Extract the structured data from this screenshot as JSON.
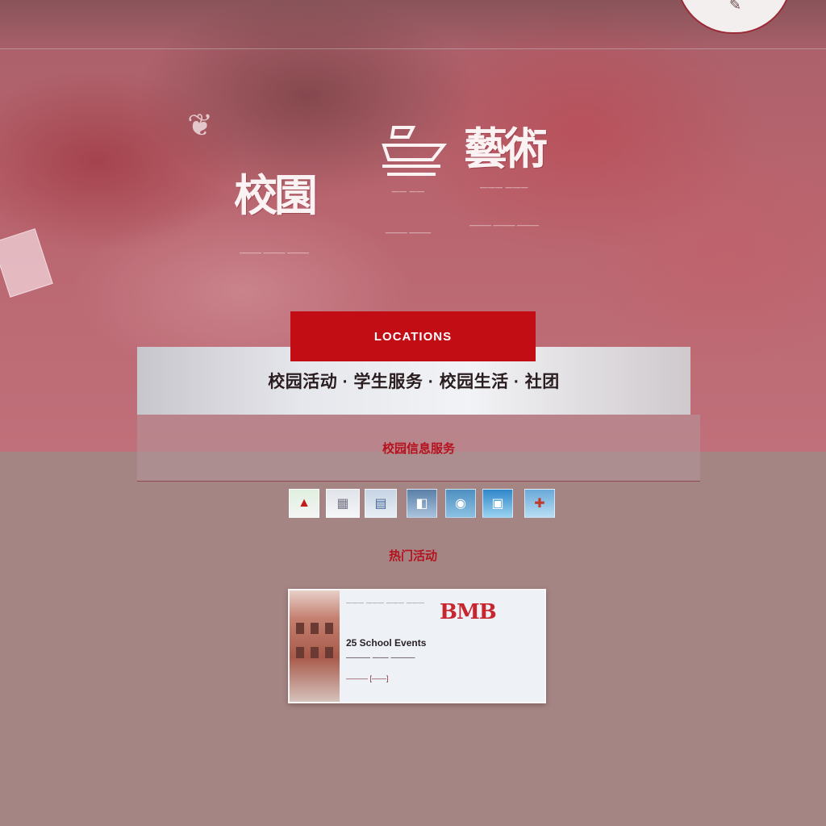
{
  "header": {
    "emblem_glyph": "❦",
    "corner_mark": "✎",
    "brand_left": {
      "title": "校園",
      "subtitle": "",
      "desc": "——— ——— ———"
    },
    "brand_center": {
      "title": "",
      "subtitle": "—— ——",
      "desc": "——— ———"
    },
    "brand_right": {
      "title": "藝術",
      "subtitle": "——— ———",
      "desc": "——— ——— ———"
    }
  },
  "cta": {
    "label": "LOCATIONS"
  },
  "banner": {
    "text": "校园活动 · 学生服务 · 校园生活 · 社团"
  },
  "panel": {
    "title": "校园信息服务"
  },
  "icons": [
    {
      "name": "campus-app-icon",
      "glyph": "▲"
    },
    {
      "name": "gallery-app-icon",
      "glyph": "▦"
    },
    {
      "name": "library-app-icon",
      "glyph": "▤"
    },
    {
      "name": "photos-app-icon",
      "glyph": "◧"
    },
    {
      "name": "maps-app-icon",
      "glyph": "◉"
    },
    {
      "name": "news-app-icon",
      "glyph": "▣"
    },
    {
      "name": "events-app-icon",
      "glyph": "✚"
    }
  ],
  "section": {
    "title": "热门活动"
  },
  "card": {
    "nav": "——— ——— ——— ———",
    "headline": "BMB",
    "line1": "25 School Events",
    "line2": "——— —— ———",
    "tag": "——— [——]"
  },
  "footer": {
    "text": ""
  },
  "colors": {
    "accent_red": "#c30d14",
    "title_red": "#b5121d",
    "background": "#a48584"
  }
}
